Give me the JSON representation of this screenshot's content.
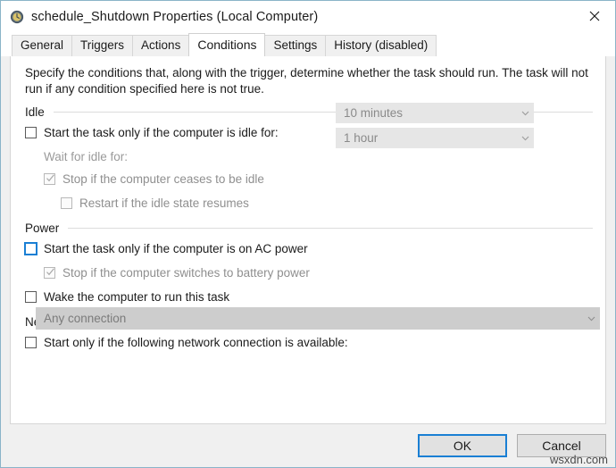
{
  "window": {
    "title": "schedule_Shutdown Properties (Local Computer)",
    "icon": "clock-icon",
    "close_label": "✕",
    "border_color": "#8ab4c8"
  },
  "tabs": [
    {
      "label": "General",
      "active": false
    },
    {
      "label": "Triggers",
      "active": false
    },
    {
      "label": "Actions",
      "active": false
    },
    {
      "label": "Conditions",
      "active": true
    },
    {
      "label": "Settings",
      "active": false
    },
    {
      "label": "History (disabled)",
      "active": false
    }
  ],
  "conditions": {
    "description": "Specify the conditions that, along with the trigger, determine whether the task should run.  The task will not run  if any condition specified here is not true.",
    "idle": {
      "group_label": "Idle",
      "start_if_idle": {
        "label": "Start the task only if the computer is idle for:",
        "checked": false,
        "disabled": false,
        "focused": false
      },
      "idle_duration_combo": {
        "value": "10 minutes",
        "disabled": true,
        "arrow": "chevron-down-icon"
      },
      "wait_for_idle_label": "Wait for idle for:",
      "wait_for_idle_combo": {
        "value": "1 hour",
        "disabled": true,
        "arrow": "chevron-down-icon"
      },
      "stop_if_ceases_idle": {
        "label": "Stop if the computer ceases to be idle",
        "checked": true,
        "disabled": true,
        "focused": false
      },
      "restart_if_idle_resumes": {
        "label": "Restart if the idle state resumes",
        "checked": false,
        "disabled": true,
        "focused": false
      }
    },
    "power": {
      "group_label": "Power",
      "start_on_ac": {
        "label": "Start the task only if the computer is on AC power",
        "checked": false,
        "disabled": false,
        "focused": true
      },
      "stop_on_battery": {
        "label": "Stop if the computer switches to battery power",
        "checked": true,
        "disabled": true,
        "focused": false
      },
      "wake_computer": {
        "label": "Wake the computer to run this task",
        "checked": false,
        "disabled": false,
        "focused": false
      }
    },
    "network": {
      "group_label": "Network",
      "start_if_network": {
        "label": "Start only if the following network connection is available:",
        "checked": false,
        "disabled": false,
        "focused": false
      },
      "connection_combo": {
        "value": "Any connection",
        "disabled": true,
        "arrow": "chevron-down-icon"
      }
    }
  },
  "footer": {
    "ok_label": "OK",
    "cancel_label": "Cancel",
    "default_button": "OK",
    "accent_color": "#1a7fd4"
  },
  "watermark": {
    "text": "wsxdn.com"
  }
}
